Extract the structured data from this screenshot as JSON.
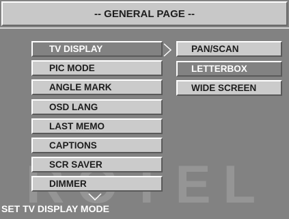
{
  "header": {
    "title": "-- GENERAL PAGE --"
  },
  "menu": {
    "items": [
      {
        "label": "TV DISPLAY",
        "selected": true
      },
      {
        "label": "PIC MODE"
      },
      {
        "label": "ANGLE MARK"
      },
      {
        "label": "OSD LANG"
      },
      {
        "label": "LAST MEMO"
      },
      {
        "label": "CAPTIONS"
      },
      {
        "label": "SCR SAVER"
      },
      {
        "label": "DIMMER"
      }
    ]
  },
  "submenu": {
    "items": [
      {
        "label": "PAN/SCAN"
      },
      {
        "label": "LETTERBOX",
        "selected": true
      },
      {
        "label": "WIDE SCREEN"
      }
    ]
  },
  "watermark": "ROTEL",
  "status": "SET TV DISPLAY MODE",
  "colors": {
    "background": "#828282",
    "button": "#cbcbcb",
    "selected": "#828282",
    "text": "#1c1c1c"
  }
}
